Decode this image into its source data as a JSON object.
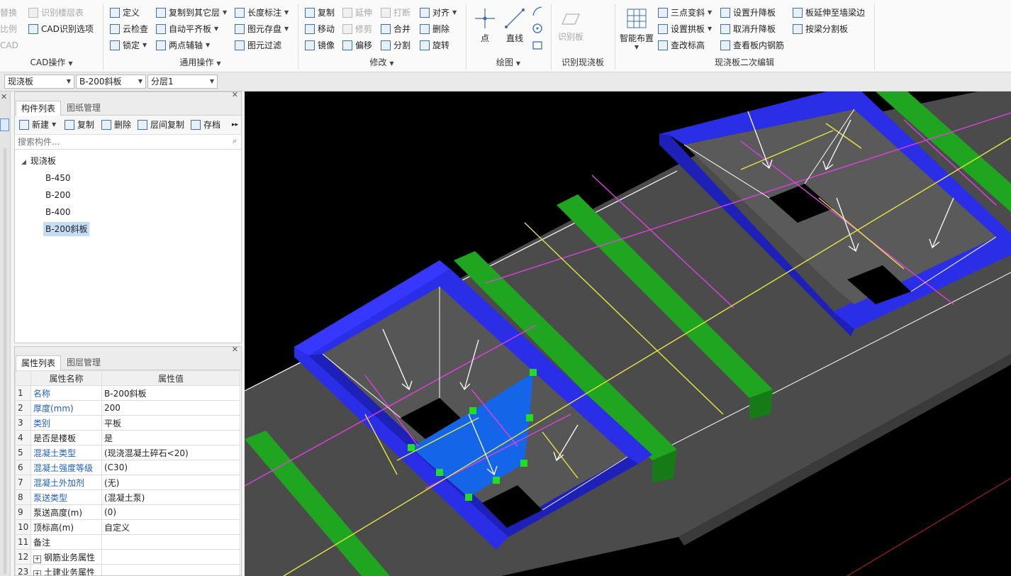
{
  "ribbon": {
    "groups": [
      {
        "label": "CAD操作"
      },
      {
        "label": "通用操作"
      },
      {
        "label": "修改"
      },
      {
        "label": "绘图"
      },
      {
        "label": "识别现浇板"
      },
      {
        "label": "现浇板二次编辑"
      }
    ],
    "cad": {
      "replace": "替换",
      "identify_floor_table": "识别楼层表",
      "scale": "比例",
      "cad_identify_options": "CAD识别选项",
      "cad": "CAD"
    },
    "common": {
      "define": "定义",
      "copy_to_other_layer": "复制到其它层",
      "length_mark": "长度标注",
      "cloud_check": "云检查",
      "auto_flat_slab": "自动平齐板",
      "element_save": "图元存盘",
      "lock": "锁定",
      "two_point_axis": "两点辅轴",
      "element_filter": "图元过滤"
    },
    "modify": {
      "copy": "复制",
      "extend": "延伸",
      "break": "打断",
      "align": "对齐",
      "move": "移动",
      "trim": "修剪",
      "merge": "合并",
      "delete": "删除",
      "mirror": "镜像",
      "offset": "偏移",
      "split": "分割",
      "rotate": "旋转"
    },
    "draw": {
      "point": "点",
      "line": "直线"
    },
    "identify": {
      "identify_slab": "识别板"
    },
    "edit2": {
      "smart_layout": "智能布置",
      "three_point_slope": "三点变斜",
      "set_raise_lower": "设置升降板",
      "extend_to_beam": "板延伸至墙梁边",
      "set_arch": "设置拱板",
      "cancel_raise_lower": "取消升降板",
      "split_by_beam": "按梁分割板",
      "check_elevation": "查改标高",
      "view_rebar": "查看板内钢筋"
    }
  },
  "selectors": [
    {
      "value": "现浇板"
    },
    {
      "value": "B-200斜板"
    },
    {
      "value": "分层1"
    }
  ],
  "component_panel": {
    "tabs": [
      "构件列表",
      "图纸管理"
    ],
    "toolbar": {
      "new": "新建",
      "copy": "复制",
      "delete": "删除",
      "layer_copy": "层间复制",
      "archive": "存档"
    },
    "search_placeholder": "搜索构件...",
    "tree_root": "现浇板",
    "items": [
      "B-450",
      "B-200",
      "B-400",
      "B-200斜板"
    ],
    "selected_index": 3
  },
  "property_panel": {
    "tabs": [
      "属性列表",
      "图层管理"
    ],
    "header": {
      "name": "属性名称",
      "value": "属性值"
    },
    "rows": [
      {
        "num": "1",
        "name": "名称",
        "value": "B-200斜板",
        "blue": true
      },
      {
        "num": "2",
        "name": "厚度(mm)",
        "value": "200",
        "blue": true
      },
      {
        "num": "3",
        "name": "类别",
        "value": "平板",
        "blue": true
      },
      {
        "num": "4",
        "name": "是否是楼板",
        "value": "是",
        "blue": false
      },
      {
        "num": "5",
        "name": "混凝土类型",
        "value": "(现浇混凝土碎石<20)",
        "blue": true
      },
      {
        "num": "6",
        "name": "混凝土强度等级",
        "value": "(C30)",
        "blue": true
      },
      {
        "num": "7",
        "name": "混凝土外加剂",
        "value": "(无)",
        "blue": true
      },
      {
        "num": "8",
        "name": "泵送类型",
        "value": "(混凝土泵)",
        "blue": true
      },
      {
        "num": "9",
        "name": "泵送高度(m)",
        "value": "(0)",
        "blue": false
      },
      {
        "num": "10",
        "name": "顶标高(m)",
        "value": "自定义",
        "blue": false
      },
      {
        "num": "11",
        "name": "备注",
        "value": "",
        "blue": false
      },
      {
        "num": "12",
        "name": "钢筋业务属性",
        "value": "",
        "blue": false,
        "expand": true
      },
      {
        "num": "23",
        "name": "土建业务属性",
        "value": "",
        "blue": false,
        "expand": true
      }
    ]
  },
  "colors": {
    "beam": "#2a2ee6",
    "green_beam": "#1fa51f",
    "slab": "#4b4b4b",
    "selected_slab": "#1565e8",
    "magenta": "#e040e0",
    "yellow": "#e6e640",
    "handle": "#22dd22"
  }
}
